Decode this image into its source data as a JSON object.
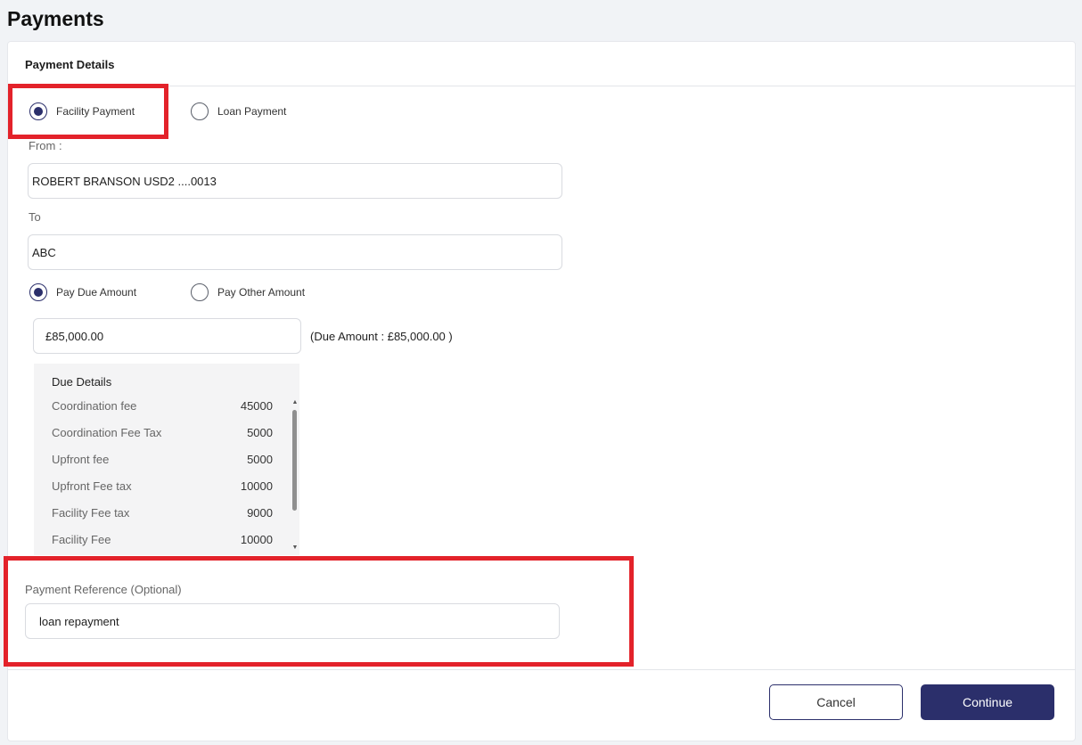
{
  "page": {
    "title": "Payments"
  },
  "card": {
    "header_title": "Payment Details"
  },
  "payment_type": {
    "options": [
      {
        "label": "Facility Payment",
        "selected": true
      },
      {
        "label": "Loan Payment",
        "selected": false
      }
    ]
  },
  "from": {
    "label": "From :",
    "value": "ROBERT BRANSON USD2 ....0013"
  },
  "to": {
    "label": "To",
    "value": "ABC"
  },
  "amount_type": {
    "options": [
      {
        "label": "Pay Due Amount",
        "selected": true
      },
      {
        "label": "Pay Other Amount",
        "selected": false
      }
    ]
  },
  "amount": {
    "value": "£85,000.00",
    "due_note": "(Due Amount : £85,000.00 )"
  },
  "due_details": {
    "title": "Due Details",
    "rows": [
      {
        "label": "Coordination fee",
        "amount": "45000"
      },
      {
        "label": "Coordination Fee Tax",
        "amount": "5000"
      },
      {
        "label": "Upfront fee",
        "amount": "5000"
      },
      {
        "label": "Upfront Fee tax",
        "amount": "10000"
      },
      {
        "label": "Facility Fee tax",
        "amount": "9000"
      },
      {
        "label": "Facility Fee",
        "amount": "10000"
      }
    ]
  },
  "reference": {
    "label": "Payment Reference (Optional)",
    "value": "loan repayment"
  },
  "actions": {
    "cancel_label": "Cancel",
    "continue_label": "Continue"
  },
  "colors": {
    "primary": "#2b2f6b",
    "highlight": "#e3222a"
  },
  "icons": {
    "scroll_up": "scroll-up-arrow-icon",
    "scroll_down": "scroll-down-arrow-icon"
  }
}
